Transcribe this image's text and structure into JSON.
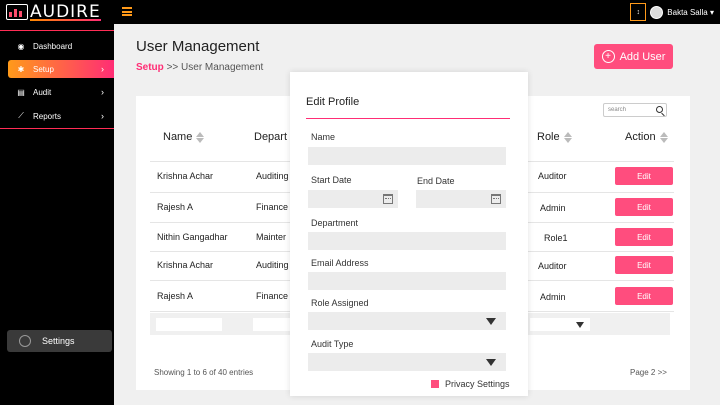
{
  "app": {
    "brand": "AUDIRE",
    "user_name": "Bakta Salla",
    "lang_symbol": "↕"
  },
  "sidebar": {
    "items": [
      {
        "label": "Dashboard",
        "icon": "dashboard-icon"
      },
      {
        "label": "Setup",
        "icon": "gear-icon",
        "active": true
      },
      {
        "label": "Audit",
        "icon": "document-icon"
      },
      {
        "label": "Reports",
        "icon": "chart-icon"
      }
    ],
    "settings_label": "Settings"
  },
  "header": {
    "title": "User Management",
    "breadcrumb": {
      "first": "Setup",
      "sep": ">>",
      "current": "User Management"
    },
    "add_user_label": "Add User",
    "add_user_symbol": "+"
  },
  "table": {
    "search_placeholder": "search",
    "columns": {
      "name": "Name",
      "department": "Depart",
      "role": "Role",
      "action": "Action"
    },
    "rows": [
      {
        "name": "Krishna Achar",
        "department": "Auditing",
        "role": "Auditor",
        "action": "Edit"
      },
      {
        "name": "Rajesh A",
        "department": "Finance",
        "role": "Admin",
        "action": "Edit"
      },
      {
        "name": "Nithin Gangadhar",
        "department": "Mainter",
        "role": "Role1",
        "action": "Edit"
      },
      {
        "name": "Krishna Achar",
        "department": "Auditing",
        "role": "Auditor",
        "action": "Edit"
      },
      {
        "name": "Rajesh A",
        "department": "Finance",
        "role": "Admin",
        "action": "Edit"
      }
    ],
    "showing": "Showing 1 to 6 of 40 entries",
    "pager": "Page 2 >>"
  },
  "modal": {
    "title": "Edit Profile",
    "labels": {
      "name": "Name",
      "start_date": "Start Date",
      "end_date": "End Date",
      "department": "Department",
      "email": "Email Address",
      "role": "Role Assigned",
      "audit_type": "Audit Type"
    },
    "privacy_label": "Privacy Settings"
  },
  "colors": {
    "accent": "#ff4d7e",
    "gradient_start": "#ff9a1a",
    "gradient_end": "#ff2d75",
    "topbar": "#000000"
  }
}
